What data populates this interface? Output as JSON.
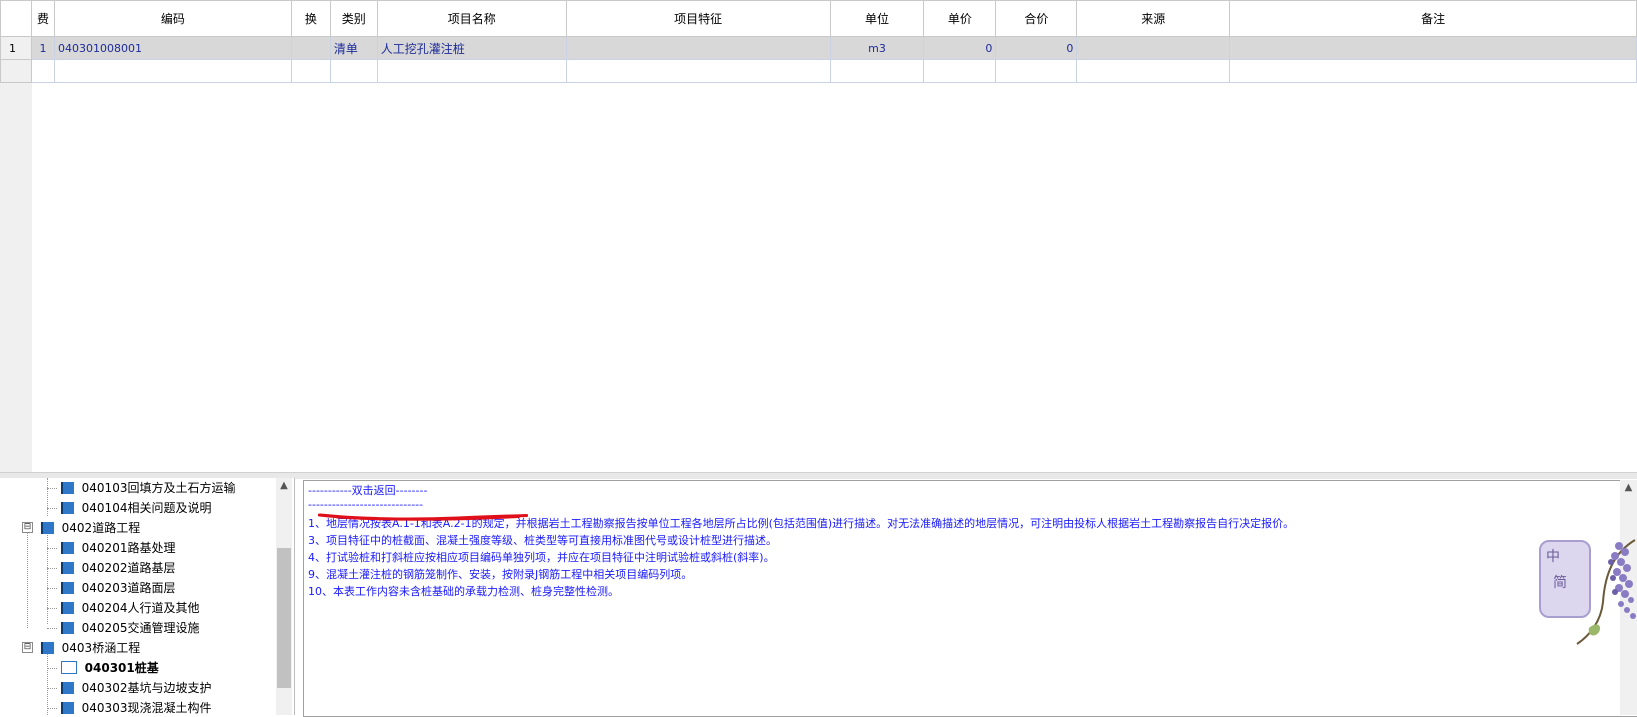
{
  "grid": {
    "columns": [
      "",
      "费",
      "编码",
      "换",
      "类别",
      "项目名称",
      "项目特征",
      "单位",
      "单价",
      "合价",
      "来源",
      "备注"
    ],
    "rows": [
      {
        "row_num": "1",
        "fee": "1",
        "code": "040301008001",
        "swap": "",
        "category": "清单",
        "name": "人工挖孔灌注桩",
        "features": "",
        "unit": "m3",
        "unit_price": "0",
        "total_price": "0",
        "source": "",
        "remark": ""
      },
      {
        "row_num": "",
        "fee": "",
        "code": "",
        "swap": "",
        "category": "",
        "name": "",
        "features": "",
        "unit": "",
        "unit_price": "",
        "total_price": "",
        "source": "",
        "remark": ""
      }
    ]
  },
  "tree": {
    "items": [
      {
        "label": "040103回填方及土石方运输",
        "level": 2,
        "icon": "book-icon"
      },
      {
        "label": "040104相关问题及说明",
        "level": 2,
        "icon": "book-icon"
      },
      {
        "label": "0402道路工程",
        "level": 1,
        "icon": "book-icon",
        "expander": "⊟"
      },
      {
        "label": "040201路基处理",
        "level": 2,
        "icon": "book-icon"
      },
      {
        "label": "040202道路基层",
        "level": 2,
        "icon": "book-icon"
      },
      {
        "label": "040203道路面层",
        "level": 2,
        "icon": "book-icon"
      },
      {
        "label": "040204人行道及其他",
        "level": 2,
        "icon": "book-icon"
      },
      {
        "label": "040205交通管理设施",
        "level": 2,
        "icon": "book-icon"
      },
      {
        "label": "0403桥涵工程",
        "level": 1,
        "icon": "book-icon",
        "expander": "⊟"
      },
      {
        "label": "040301桩基",
        "level": 2,
        "icon": "open-book-icon",
        "selected": true
      },
      {
        "label": "040302基坑与边坡支护",
        "level": 2,
        "icon": "book-icon"
      },
      {
        "label": "040303现浇混凝土构件",
        "level": 2,
        "icon": "book-icon"
      }
    ]
  },
  "notes": {
    "back_link": "-----------双击返回--------",
    "separator": "-----------------------------",
    "lines": [
      "1、地层情况按表A.1-1和表A.2-1的规定，并根据岩土工程勘察报告按单位工程各地层所占比例(包括范围值)进行描述。对无法准确描述的地层情况，可注明由投标人根据岩土工程勘察报告自行决定报价。",
      "3、项目特征中的桩截面、混凝土强度等级、桩类型等可直接用标准图代号或设计桩型进行描述。",
      "4、打试验桩和打斜桩应按相应项目编码单独列项，并应在项目特征中注明试验桩或斜桩(斜率)。",
      "9、混凝土灌注桩的钢筋笼制作、安装，按附录J钢筋工程中相关项目编码列项。",
      "10、本表工作内容未含桩基础的承载力检测、桩身完整性检测。"
    ]
  },
  "ime": {
    "char1": "中",
    "char2": "简"
  },
  "colors": {
    "note_text": "#1a1aff",
    "selected_row": "#d8d8d8",
    "annotation": "#e0101a"
  }
}
